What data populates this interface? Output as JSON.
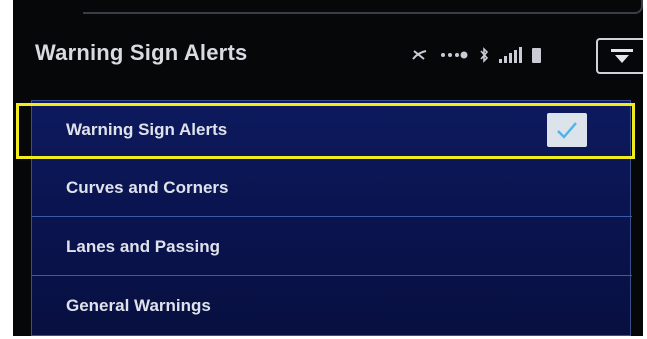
{
  "header": {
    "title": "Warning Sign Alerts",
    "status_icons": [
      "no-phone-icon",
      "dots-icon",
      "bluetooth-icon",
      "signal-icon",
      "battery-icon"
    ],
    "menu_icon": "menu-icon"
  },
  "list": {
    "items": [
      {
        "label": "Warning Sign Alerts",
        "checked": true
      },
      {
        "label": "Curves and Corners"
      },
      {
        "label": "Lanes and Passing"
      },
      {
        "label": "General Warnings"
      }
    ]
  },
  "colors": {
    "highlight": "#f2ec1f",
    "check": "#4fb3e8",
    "list_bg": "#0c1858",
    "screen_bg": "#060709"
  }
}
